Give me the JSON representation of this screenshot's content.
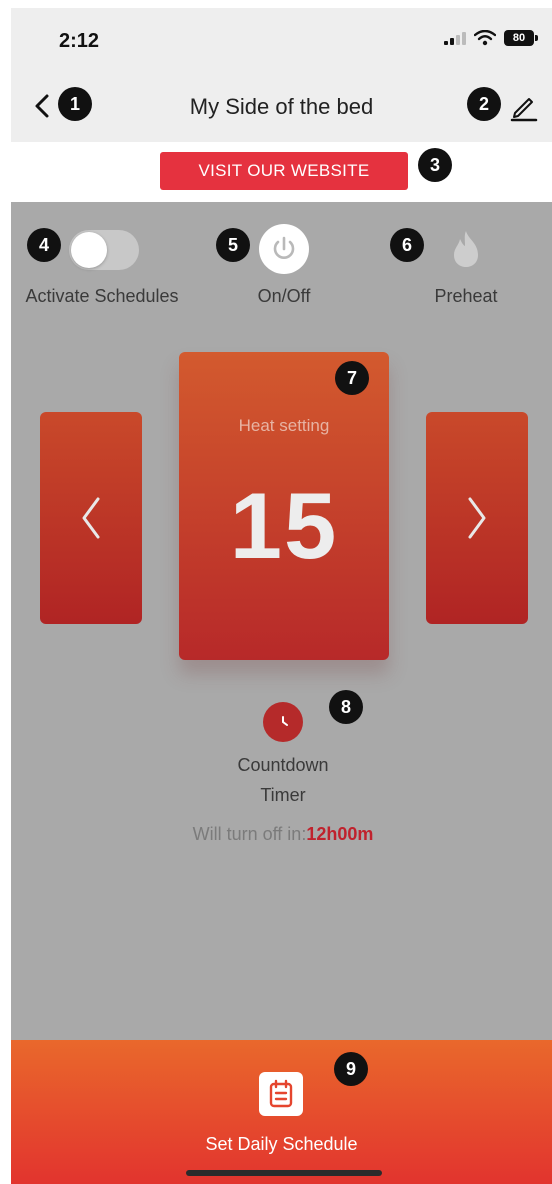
{
  "status_bar": {
    "time": "2:12",
    "battery": "80"
  },
  "header": {
    "title": "My Side of the bed",
    "back_icon": "chevron-left-icon",
    "edit_icon": "pencil-icon"
  },
  "website": {
    "label": "VISIT OUR WEBSITE"
  },
  "controls": {
    "schedules_label": "Activate Schedules",
    "schedules_on": false,
    "power_label": "On/Off",
    "preheat_label": "Preheat"
  },
  "heat": {
    "label": "Heat setting",
    "value": "15"
  },
  "timer": {
    "label_line1": "Countdown",
    "label_line2": "Timer",
    "turnoff_prefix": "Will turn off in:",
    "turnoff_value": "12h00m"
  },
  "bottom": {
    "schedule_label": "Set Daily Schedule"
  },
  "markers": [
    "1",
    "2",
    "3",
    "4",
    "5",
    "6",
    "7",
    "8",
    "9"
  ],
  "colors": {
    "accent": "#e5323f",
    "card": "#c23a2a",
    "main_bg": "#a9a9a9",
    "bottom_top": "#e9682c",
    "bottom_bottom": "#e2342e"
  }
}
